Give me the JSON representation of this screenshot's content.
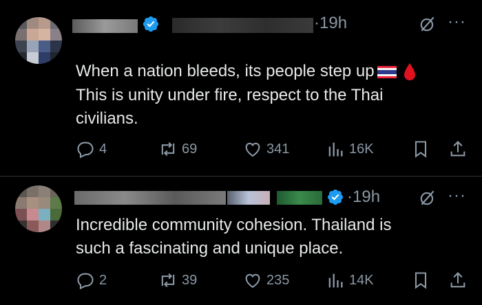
{
  "tweets": [
    {
      "time": "·19h",
      "text_line1": "When a nation bleeds, its people step up",
      "text_rest": "This is unity under fire, respect to the Thai\ncivilians.",
      "replies": "4",
      "reposts": "69",
      "likes": "341",
      "views": "16K"
    },
    {
      "time": "·19h",
      "text": "Incredible community cohesion. Thailand is\nsuch a fascinating and unique place.",
      "replies": "2",
      "reposts": "39",
      "likes": "235",
      "views": "14K"
    }
  ],
  "more_glyph": "···",
  "colors": {
    "background": "#000000",
    "text": "#e7e9ea",
    "muted": "#8b98a5",
    "verified": "#1d9bf0",
    "divider": "#2f3336"
  },
  "icons": [
    "verified-badge-icon",
    "grok-icon",
    "more-icon",
    "reply-icon",
    "repost-icon",
    "like-icon",
    "views-icon",
    "bookmark-icon",
    "share-icon",
    "thailand-flag-icon",
    "blood-drop-icon"
  ]
}
